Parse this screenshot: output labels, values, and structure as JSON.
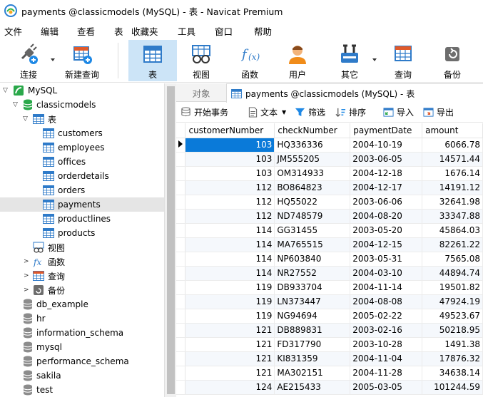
{
  "window": {
    "title": "payments @classicmodels (MySQL) - 表 - Navicat Premium"
  },
  "menu": [
    "文件",
    "编辑",
    "查看",
    "表",
    "收藏夹",
    "工具",
    "窗口",
    "帮助"
  ],
  "toolbar": {
    "connect": "连接",
    "new_query": "新建查询",
    "table": "表",
    "view": "视图",
    "function": "函数",
    "user": "用户",
    "other": "其它",
    "query": "查询",
    "backup": "备份"
  },
  "tree": {
    "connection": "MySQL",
    "database": "classicmodels",
    "tables_group": "表",
    "tables": [
      "customers",
      "employees",
      "offices",
      "orderdetails",
      "orders",
      "payments",
      "productlines",
      "products"
    ],
    "selected_table": "payments",
    "views_group": "视图",
    "functions_group": "函数",
    "queries_group": "查询",
    "backups_group": "备份",
    "other_databases": [
      "db_example",
      "hr",
      "information_schema",
      "mysql",
      "performance_schema",
      "sakila",
      "test"
    ]
  },
  "tabs": {
    "objects": "对象",
    "active": "payments @classicmodels (MySQL) - 表"
  },
  "subtoolbar": {
    "begin_transaction": "开始事务",
    "text": "文本",
    "filter": "筛选",
    "sort": "排序",
    "import": "导入",
    "export": "导出"
  },
  "grid": {
    "columns": [
      "customerNumber",
      "checkNumber",
      "paymentDate",
      "amount"
    ],
    "rows": [
      [
        "103",
        "HQ336336",
        "2004-10-19",
        "6066.78"
      ],
      [
        "103",
        "JM555205",
        "2003-06-05",
        "14571.44"
      ],
      [
        "103",
        "OM314933",
        "2004-12-18",
        "1676.14"
      ],
      [
        "112",
        "BO864823",
        "2004-12-17",
        "14191.12"
      ],
      [
        "112",
        "HQ55022",
        "2003-06-06",
        "32641.98"
      ],
      [
        "112",
        "ND748579",
        "2004-08-20",
        "33347.88"
      ],
      [
        "114",
        "GG31455",
        "2003-05-20",
        "45864.03"
      ],
      [
        "114",
        "MA765515",
        "2004-12-15",
        "82261.22"
      ],
      [
        "114",
        "NP603840",
        "2003-05-31",
        "7565.08"
      ],
      [
        "114",
        "NR27552",
        "2004-03-10",
        "44894.74"
      ],
      [
        "119",
        "DB933704",
        "2004-11-14",
        "19501.82"
      ],
      [
        "119",
        "LN373447",
        "2004-08-08",
        "47924.19"
      ],
      [
        "119",
        "NG94694",
        "2005-02-22",
        "49523.67"
      ],
      [
        "121",
        "DB889831",
        "2003-02-16",
        "50218.95"
      ],
      [
        "121",
        "FD317790",
        "2003-10-28",
        "1491.38"
      ],
      [
        "121",
        "KI831359",
        "2004-11-04",
        "17876.32"
      ],
      [
        "121",
        "MA302151",
        "2004-11-28",
        "34638.14"
      ],
      [
        "124",
        "AE215433",
        "2005-03-05",
        "101244.59"
      ]
    ]
  },
  "colors": {
    "selection": "#0a7ad9",
    "active_tool": "#cce4f7",
    "db_icon": "#2aa84a",
    "table_icon": "#2f7bc9"
  }
}
